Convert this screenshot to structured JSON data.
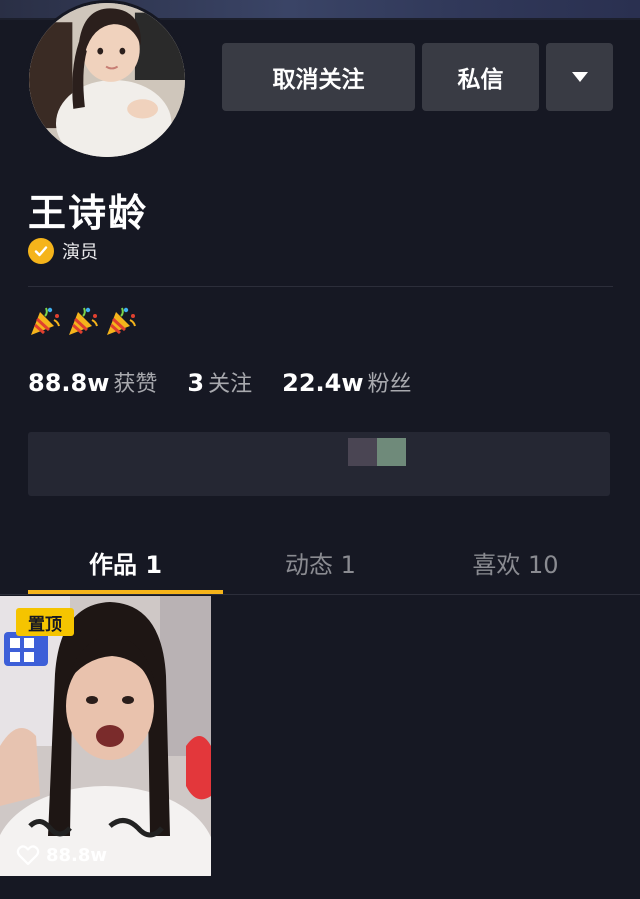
{
  "profile": {
    "name": "王诗龄",
    "verified_label": "演员",
    "emojis": [
      "party-popper-icon",
      "party-popper-icon",
      "party-popper-icon"
    ]
  },
  "actions": {
    "unfollow_label": "取消关注",
    "message_label": "私信",
    "more": "chevron-down-icon"
  },
  "stats": [
    {
      "value": "88.8w",
      "label": "获赞"
    },
    {
      "value": "3",
      "label": "关注"
    },
    {
      "value": "22.4w",
      "label": "粉丝"
    }
  ],
  "tabs": [
    {
      "label": "作品 1",
      "active": true
    },
    {
      "label": "动态 1",
      "active": false
    },
    {
      "label": "喜欢 10",
      "active": false
    }
  ],
  "works": [
    {
      "pinned_label": "置顶",
      "likes": "88.8w"
    }
  ],
  "colors": {
    "background": "#161823",
    "button": "#393b44",
    "accent": "#f5b41b",
    "pin": "#f5c400"
  }
}
